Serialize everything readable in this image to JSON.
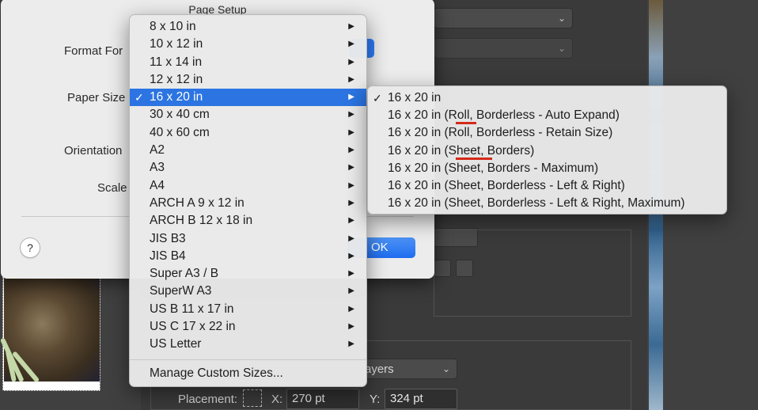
{
  "dialog": {
    "title": "Page Setup",
    "labels": {
      "format_for": "Format For",
      "paper_size": "Paper Size",
      "orientation": "Orientation",
      "scale": "Scale"
    },
    "help_label": "?",
    "ok_label": "OK"
  },
  "paper_menu": {
    "items": [
      {
        "label": "8 x 10 in"
      },
      {
        "label": "10 x 12 in"
      },
      {
        "label": "11 x 14 in"
      },
      {
        "label": "12 x 12 in"
      },
      {
        "label": "16 x 20 in"
      },
      {
        "label": "30 x 40 cm"
      },
      {
        "label": "40 x 60 cm"
      },
      {
        "label": "A2"
      },
      {
        "label": "A3"
      },
      {
        "label": "A4"
      },
      {
        "label": "ARCH A 9 x 12 in"
      },
      {
        "label": "ARCH B 12 x 18 in"
      },
      {
        "label": "JIS B3"
      },
      {
        "label": "JIS B4"
      },
      {
        "label": "Super A3 / B"
      },
      {
        "label": "SuperW A3"
      },
      {
        "label": "US B 11 x 17 in"
      },
      {
        "label": "US C 17 x 22 in"
      },
      {
        "label": "US Letter"
      }
    ],
    "selected_label": "16 x 20 in",
    "manage_label": "Manage Custom Sizes...",
    "check_glyph": "✓",
    "arrow_glyph": "▶"
  },
  "paper_submenu": {
    "items": [
      {
        "label": "16 x 20 in",
        "checked": true
      },
      {
        "label": "16 x 20 in (Roll, Borderless - Auto Expand)"
      },
      {
        "label": "16 x 20 in (Roll, Borderless - Retain Size)"
      },
      {
        "label": "16 x 20 in (Sheet, Borders)"
      },
      {
        "label": "16 x 20 in (Sheet, Borders - Maximum)"
      },
      {
        "label": "16 x 20 in (Sheet, Borderless - Left & Right)"
      },
      {
        "label": "16 x 20 in (Sheet, Borderless - Left & Right, Maximum)"
      }
    ]
  },
  "print_panel": {
    "layers_value": "ayers",
    "placement_label": "Placement:",
    "x_label": "X:",
    "x_value": "270 pt",
    "y_label": "Y:",
    "y_value": "324 pt"
  },
  "colors": {
    "menu_highlight": "#2b74e2",
    "ok_button": "#1e6df0",
    "annotation_underline": "#d42a1a"
  }
}
